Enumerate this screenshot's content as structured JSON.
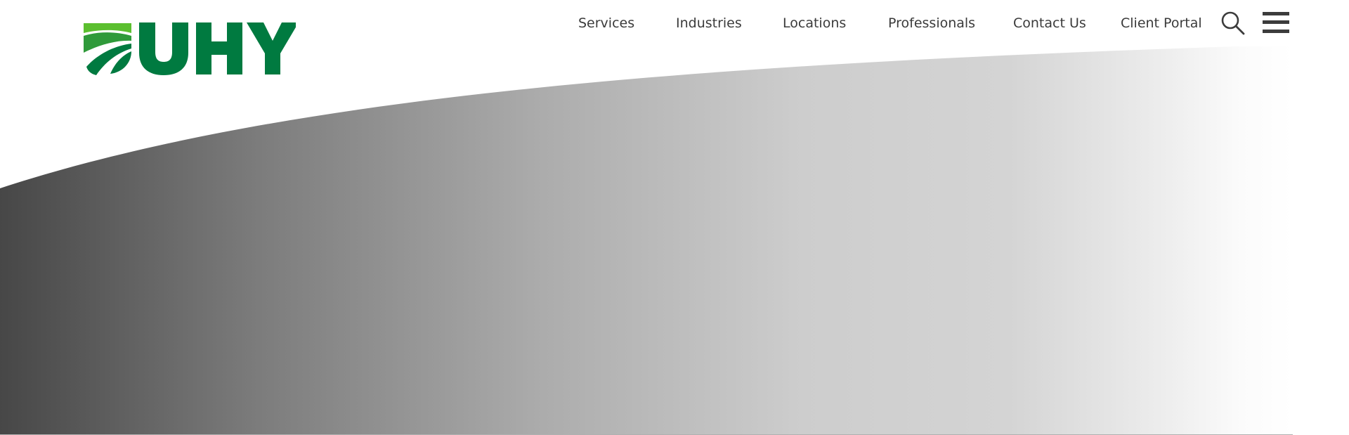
{
  "brand": {
    "name": "UHY",
    "primary_color": "#007a40",
    "accent_color": "#5bbf2f"
  },
  "nav": {
    "items": [
      {
        "label": "Services"
      },
      {
        "label": "Industries"
      },
      {
        "label": "Locations"
      },
      {
        "label": "Professionals"
      },
      {
        "label": "Contact Us"
      },
      {
        "label": "Client Portal"
      }
    ],
    "search_icon": "search-icon",
    "menu_icon": "hamburger-menu-icon"
  },
  "hero": {
    "gradient_start": "#474747",
    "gradient_mid": "#cfcfcf",
    "gradient_end": "#ffffff"
  }
}
